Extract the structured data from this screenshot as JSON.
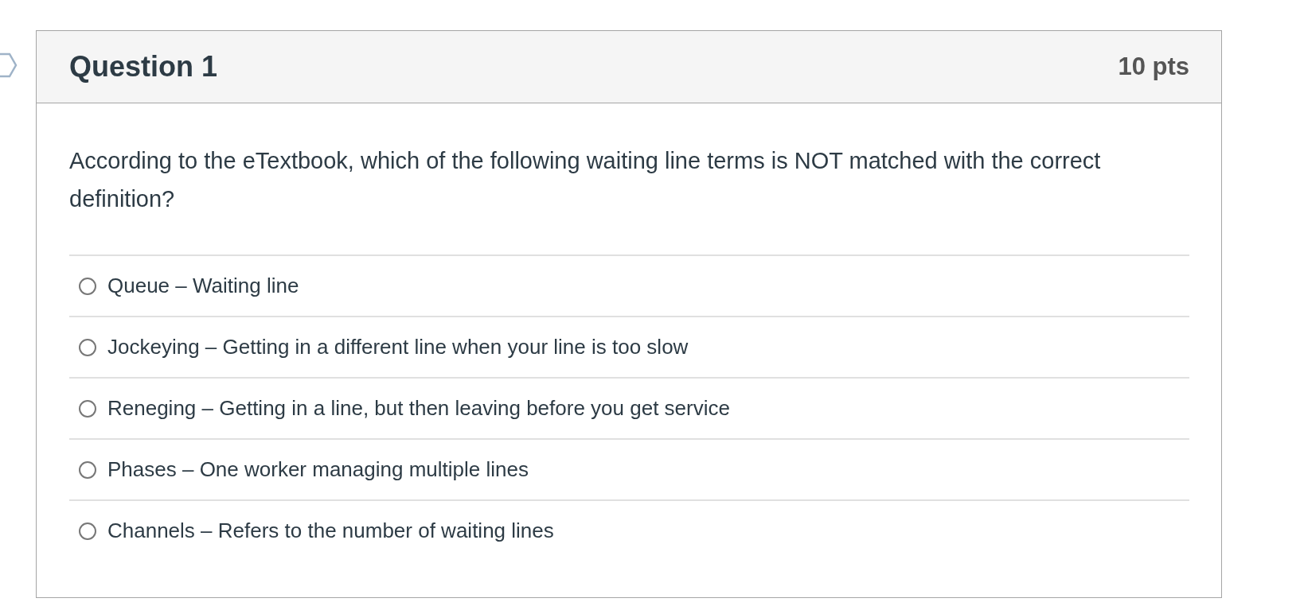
{
  "question": {
    "title": "Question 1",
    "points": "10 pts",
    "text": "According to the eTextbook, which of the following waiting line terms is NOT matched with the correct definition?"
  },
  "answers": [
    {
      "label": "Queue – Waiting line",
      "selected": false
    },
    {
      "label": "Jockeying – Getting in a different line when your line is too slow",
      "selected": false
    },
    {
      "label": "Reneging – Getting in a line, but then leaving before you get service",
      "selected": false
    },
    {
      "label": "Phases – One worker managing multiple lines",
      "selected": false
    },
    {
      "label": "Channels – Refers to the number of waiting lines",
      "selected": false
    }
  ]
}
